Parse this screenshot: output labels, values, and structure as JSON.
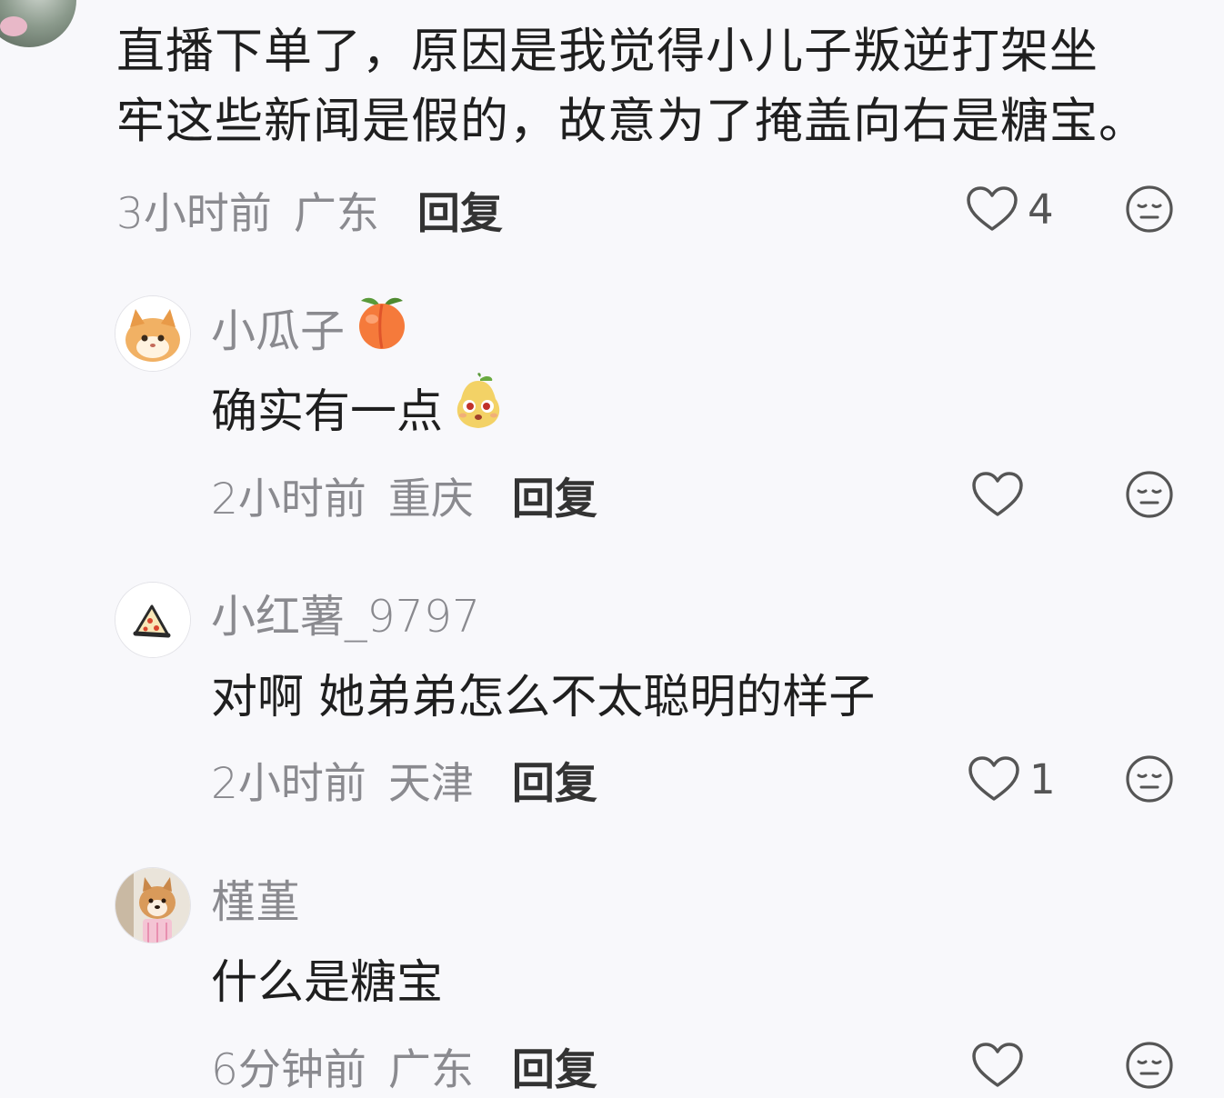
{
  "top_comment": {
    "text_line1": "直播下单了，原因是我觉得小儿子叛逆打架坐",
    "text_line2": "牢这些新闻是假的，故意为了掩盖向右是糖宝。",
    "time": "3小时前",
    "location": "广东",
    "reply_label": "回复",
    "likes": "4"
  },
  "replies": [
    {
      "username": "小瓜子",
      "badge": "peach-emoji",
      "text": "确实有一点",
      "text_emoji": "pear-face-emoji",
      "time": "2小时前",
      "location": "重庆",
      "reply_label": "回复",
      "likes": ""
    },
    {
      "username": "小红薯_9797",
      "text": "对啊 她弟弟怎么不太聪明的样子",
      "time": "2小时前",
      "location": "天津",
      "reply_label": "回复",
      "likes": "1"
    },
    {
      "username": "槿堇",
      "text": "什么是糖宝",
      "time": "6分钟前",
      "location": "广东",
      "reply_label": "回复",
      "likes": ""
    }
  ],
  "colors": {
    "background": "#f8f8fb",
    "text": "#1f1f1f",
    "meta": "#8a8a8f",
    "icon": "#555555"
  }
}
